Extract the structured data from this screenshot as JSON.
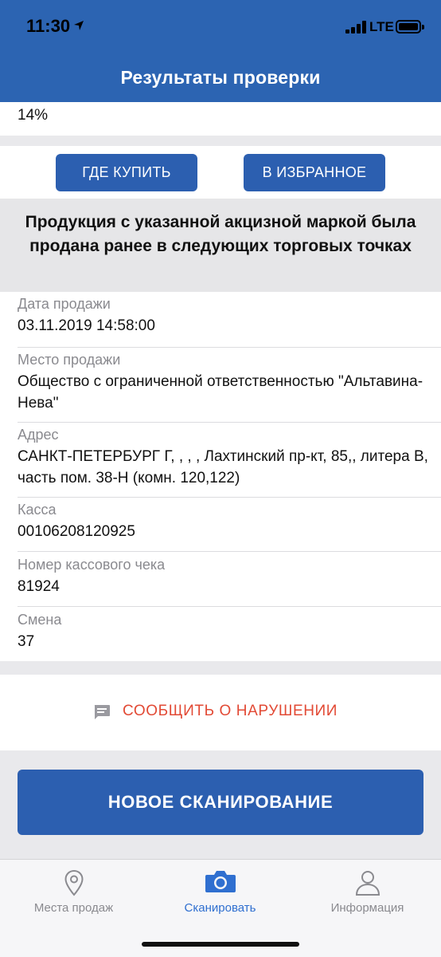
{
  "status_bar": {
    "time": "11:30",
    "network": "LTE"
  },
  "header": {
    "title": "Результаты проверки"
  },
  "percent_value": "14%",
  "actions": {
    "where_to_buy": "ГДЕ КУПИТЬ",
    "add_favorite": "В ИЗБРАННОЕ"
  },
  "sold_notice": "Продукция с указанной акцизной маркой была продана ранее в следующих торговых точках",
  "details": [
    {
      "label": "Дата продажи",
      "value": "03.11.2019 14:58:00"
    },
    {
      "label": "Место продажи",
      "value": "Общество с ограниченной ответственностью \"Альтавина-Нева\""
    },
    {
      "label": "Адрес",
      "value": "САНКТ-ПЕТЕРБУРГ Г, , , , Лахтинский пр-кт, 85,, литера В, часть пом. 38-Н (комн. 120,122)"
    },
    {
      "label": "Касса",
      "value": "00106208120925"
    },
    {
      "label": "Номер кассового чека",
      "value": "81924"
    },
    {
      "label": "Смена",
      "value": "37"
    }
  ],
  "report_violation": "СООБЩИТЬ О НАРУШЕНИИ",
  "new_scan": "НОВОЕ СКАНИРОВАНИЕ",
  "tabs": [
    {
      "label": "Места продаж",
      "icon": "map-pin-icon"
    },
    {
      "label": "Сканировать",
      "icon": "camera-icon"
    },
    {
      "label": "Информация",
      "icon": "person-icon"
    }
  ],
  "colors": {
    "primary": "#2c5fb0",
    "header": "#2c64b2",
    "danger": "#e24a35",
    "tab_active": "#2f6fd0"
  }
}
